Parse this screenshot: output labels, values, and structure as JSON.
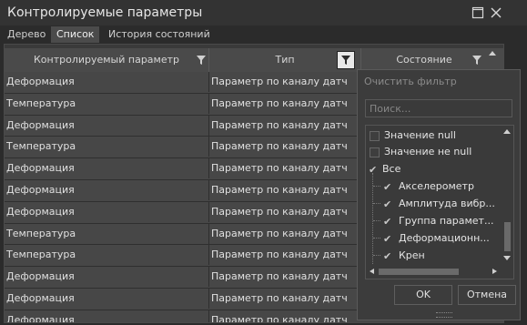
{
  "window": {
    "title": "Контролируемые параметры"
  },
  "tabs": [
    {
      "label": "Дерево"
    },
    {
      "label": "Список"
    },
    {
      "label": "История состояний"
    }
  ],
  "table": {
    "columns": [
      {
        "label": "Контролируемый параметр"
      },
      {
        "label": "Тип"
      },
      {
        "label": "Состояние"
      }
    ],
    "rows": [
      {
        "param": "Деформация",
        "type": "Параметр по каналу датчика"
      },
      {
        "param": "Температура",
        "type": "Параметр по каналу датчика"
      },
      {
        "param": "Деформация",
        "type": "Параметр по каналу датчика"
      },
      {
        "param": "Температура",
        "type": "Параметр по каналу датчика"
      },
      {
        "param": "Деформация",
        "type": "Параметр по каналу датчика"
      },
      {
        "param": "Деформация",
        "type": "Параметр по каналу датчика"
      },
      {
        "param": "Деформация",
        "type": "Параметр по каналу датчика"
      },
      {
        "param": "Температура",
        "type": "Параметр по каналу датчика"
      },
      {
        "param": "Температура",
        "type": "Параметр по каналу датчика"
      },
      {
        "param": "Деформация",
        "type": "Параметр по каналу датчика"
      },
      {
        "param": "Деформация",
        "type": "Параметр по каналу датчика"
      },
      {
        "param": "Деформация",
        "type": "Параметр по каналу датчика"
      }
    ]
  },
  "filter_popup": {
    "clear_label": "Очистить фильтр",
    "search_placeholder": "Поиск...",
    "items": [
      {
        "label": "Значение null",
        "checked": false
      },
      {
        "label": "Значение не null",
        "checked": false
      },
      {
        "label": "Все",
        "checked": true
      },
      {
        "label": "Акселерометр",
        "checked": true
      },
      {
        "label": "Амплитуда вибр...",
        "checked": true
      },
      {
        "label": "Группа парамет...",
        "checked": true
      },
      {
        "label": "Деформационн...",
        "checked": true
      },
      {
        "label": "Крен",
        "checked": true
      }
    ],
    "ok_label": "OK",
    "cancel_label": "Отмена"
  },
  "icons": {
    "maximize": "maximize-icon",
    "close": "close-icon",
    "filter": "filter-icon",
    "scroll_up": "scroll-up-icon",
    "checkmark": "checkmark-icon"
  },
  "colors": {
    "background": "#2b2b2b",
    "header": "#4a4a4a",
    "row": "#474747",
    "popup": "#3c3c3c"
  }
}
